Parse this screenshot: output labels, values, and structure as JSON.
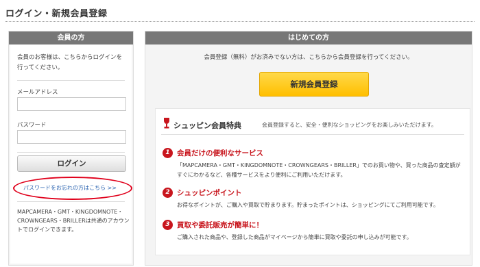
{
  "page": {
    "title": "ログイン・新規会員登録"
  },
  "member": {
    "header": "会員の方",
    "intro": "会員のお客様は、こちらからログインを行ってください。",
    "email_label": "メールアドレス",
    "password_label": "パスワード",
    "email_value": "",
    "password_value": "",
    "login_button": "ログイン",
    "forgot_link": "パスワードをお忘れの方はこちら >>",
    "shared_note": "MAPCAMERA・GMT・KINGDOMNOTE・CROWNGEARS・BRILLERは共通のアカウントでログインできます。"
  },
  "new_member": {
    "header": "はじめての方",
    "note": "会員登録（無料）がお済みでない方は、こちらから会員登録を行ってください。",
    "register_button": "新規会員登録"
  },
  "benefits": {
    "title": "シュッピン会員特典",
    "subtitle": "会員登録すると、安全・便利なショッピングをお楽しみいただけます。",
    "items": [
      {
        "num": "1",
        "head": "会員だけの便利なサービス",
        "desc": "「MAPCAMERA・GMT・KINGDOMNOTE・CROWNGEARS・BRILLER」でのお買い物や、買った商品の査定額がすぐにわかるなど、各種サービスをより便利にご利用いただけます。"
      },
      {
        "num": "2",
        "head": "シュッピンポイント",
        "desc": "お得なポイントが、ご購入や買取で貯まります。貯まったポイントは、ショッピングにてご利用可能です。"
      },
      {
        "num": "3",
        "head": "買取や委託販売が簡単に！",
        "desc": "ご購入された商品や、登録した商品がマイページから簡単に買取や委託の申し込みが可能です。"
      }
    ]
  },
  "colors": {
    "accent_red": "#c8151d",
    "header_gray": "#777777",
    "button_yellow": "#ffc800",
    "link_blue": "#2a63b0",
    "annotation_red": "#e0001b"
  }
}
